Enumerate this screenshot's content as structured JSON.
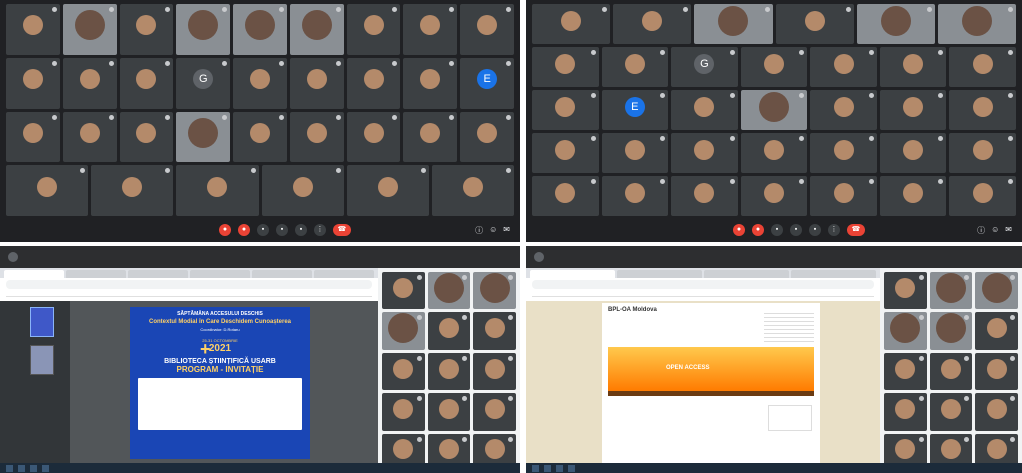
{
  "q1": {
    "rows": [
      [
        {
          "n": "",
          "v": false
        },
        {
          "n": "",
          "v": true
        },
        {
          "n": "",
          "v": false
        },
        {
          "n": "",
          "v": true
        },
        {
          "n": "",
          "v": true
        },
        {
          "n": "",
          "v": true
        },
        {
          "n": "",
          "v": false
        },
        {
          "n": "",
          "v": false
        },
        {
          "n": "",
          "v": false
        }
      ],
      [
        {
          "n": "",
          "v": false
        },
        {
          "n": "",
          "v": false
        },
        {
          "n": "",
          "v": false
        },
        {
          "n": "",
          "v": false,
          "l": "G"
        },
        {
          "n": "",
          "v": false
        },
        {
          "n": "",
          "v": false
        },
        {
          "n": "",
          "v": false
        },
        {
          "n": "",
          "v": false
        },
        {
          "n": "",
          "v": false,
          "l": "E"
        }
      ],
      [
        {
          "n": "",
          "v": false
        },
        {
          "n": "",
          "v": false
        },
        {
          "n": "",
          "v": false
        },
        {
          "n": "",
          "v": true
        },
        {
          "n": "",
          "v": false
        },
        {
          "n": "",
          "v": false
        },
        {
          "n": "",
          "v": false
        },
        {
          "n": "",
          "v": false
        },
        {
          "n": "",
          "v": false
        }
      ],
      [
        {
          "n": "",
          "v": false
        },
        {
          "n": "",
          "v": false
        },
        {
          "n": "",
          "v": false
        },
        {
          "n": "",
          "v": false
        },
        {
          "n": "",
          "v": false
        },
        {
          "n": "",
          "v": false
        }
      ]
    ]
  },
  "q2": {
    "rows": [
      [
        {
          "n": "",
          "v": false
        },
        {
          "n": "",
          "v": false
        },
        {
          "n": "",
          "v": true
        },
        {
          "n": "",
          "v": false
        },
        {
          "n": "",
          "v": true
        },
        {
          "n": "",
          "v": true
        }
      ],
      [
        {
          "n": "",
          "v": false
        },
        {
          "n": "",
          "v": false
        },
        {
          "n": "",
          "v": false,
          "l": "G"
        },
        {
          "n": "",
          "v": false
        },
        {
          "n": "",
          "v": false
        },
        {
          "n": "",
          "v": false
        },
        {
          "n": "",
          "v": false
        }
      ],
      [
        {
          "n": "",
          "v": false
        },
        {
          "n": "",
          "v": false,
          "l": "E"
        },
        {
          "n": "",
          "v": false
        },
        {
          "n": "",
          "v": true
        },
        {
          "n": "",
          "v": false
        },
        {
          "n": "",
          "v": false
        },
        {
          "n": "",
          "v": false
        }
      ],
      [
        {
          "n": "",
          "v": false
        },
        {
          "n": "",
          "v": false
        },
        {
          "n": "",
          "v": false
        },
        {
          "n": "",
          "v": false
        },
        {
          "n": "",
          "v": false
        },
        {
          "n": "",
          "v": false
        },
        {
          "n": "",
          "v": false
        }
      ],
      [
        {
          "n": "",
          "v": false
        },
        {
          "n": "",
          "v": false
        },
        {
          "n": "",
          "v": false
        },
        {
          "n": "",
          "v": false
        },
        {
          "n": "",
          "v": false
        },
        {
          "n": "",
          "v": false
        },
        {
          "n": "",
          "v": false
        }
      ]
    ]
  },
  "q3": {
    "page": {
      "t1": "SĂPTĂMÂNA ACCESULUI DESCHIS",
      "t2": "Contextul Modial în Care Deschidem Cunoașterea",
      "t3": "Coordinator: D.Rotaru",
      "days": "25-31 OCTOMBRIE",
      "year": "2021",
      "t4": "BIBLIOTECA ȘTIINȚIFICĂ USARB",
      "t5": "PROGRAM - INVITAȚIE"
    }
  },
  "q4": {
    "blog_title": "BPL-OA Moldova",
    "banner": "OPEN ACCESS"
  },
  "colors": {
    "meet_bg": "#202124",
    "tile_bg": "#3c4043",
    "leave": "#ea4335",
    "pdf_page": "#1a46b5",
    "accent_yellow": "#ffd166"
  },
  "icons": [
    "mic-icon",
    "camera-icon",
    "present-icon",
    "more-icon",
    "leave-call-icon",
    "info-icon",
    "people-icon",
    "chat-icon",
    "windows-icon"
  ]
}
